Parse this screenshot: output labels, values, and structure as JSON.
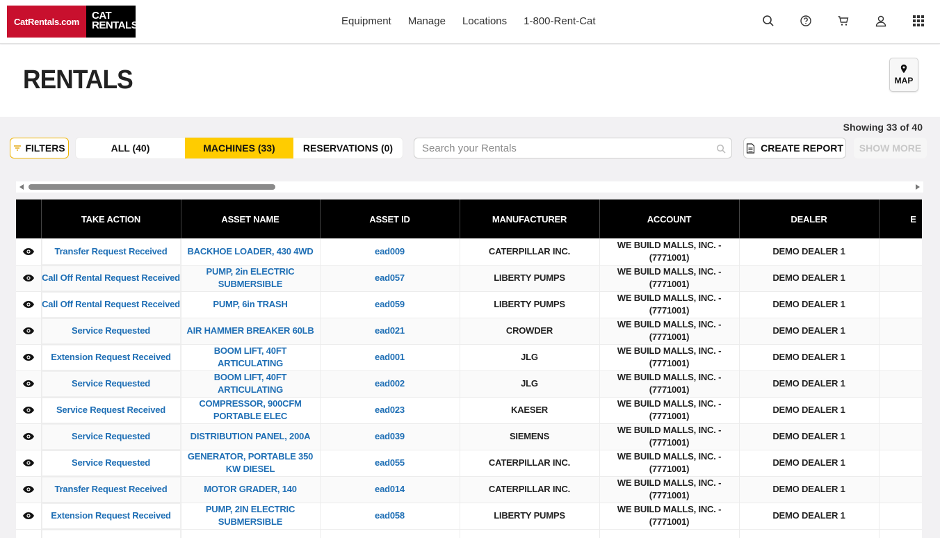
{
  "brand": {
    "logo_left": "CatRentals.com",
    "logo_cat": "CAT",
    "logo_rentals": "RENTALS",
    "accent": "#ffcc00",
    "red": "#c8102e"
  },
  "nav": {
    "items": [
      "Equipment",
      "Manage",
      "Locations",
      "1-800-Rent-Cat"
    ]
  },
  "top_icons": [
    "search-icon",
    "help-icon",
    "cart-icon",
    "user-icon",
    "apps-grid-icon"
  ],
  "header": {
    "title": "RENTALS",
    "map_label": "MAP"
  },
  "toolbar": {
    "showing": "Showing 33 of 40",
    "filters_label": "FILTERS",
    "tabs": [
      {
        "label": "ALL (40)",
        "selected": false
      },
      {
        "label": "MACHINES (33)",
        "selected": true
      },
      {
        "label": "RESERVATIONS (0)",
        "selected": false
      }
    ],
    "search_placeholder": "Search your Rentals",
    "create_report_label": "CREATE REPORT",
    "show_more_label": "SHOW MORE"
  },
  "table": {
    "columns": [
      "TAKE ACTION",
      "ASSET NAME",
      "ASSET ID",
      "MANUFACTURER",
      "ACCOUNT",
      "DEALER",
      "E"
    ],
    "rows": [
      {
        "action": "Transfer Request Received",
        "asset_name": "BACKHOE LOADER, 430 4WD",
        "asset_id": "ead009",
        "manufacturer": "CATERPILLAR INC.",
        "account": "WE BUILD MALLS, INC. - (7771001)",
        "dealer": "DEMO DEALER 1"
      },
      {
        "action": "Call Off Rental Request Received",
        "asset_name": "PUMP, 2in ELECTRIC SUBMERSIBLE",
        "asset_id": "ead057",
        "manufacturer": "LIBERTY PUMPS",
        "account": "WE BUILD MALLS, INC. - (7771001)",
        "dealer": "DEMO DEALER 1"
      },
      {
        "action": "Call Off Rental Request Received",
        "asset_name": "PUMP, 6in TRASH",
        "asset_id": "ead059",
        "manufacturer": "LIBERTY PUMPS",
        "account": "WE BUILD MALLS, INC. - (7771001)",
        "dealer": "DEMO DEALER 1"
      },
      {
        "action": "Service Requested",
        "asset_name": "AIR HAMMER BREAKER 60LB",
        "asset_id": "ead021",
        "manufacturer": "CROWDER",
        "account": "WE BUILD MALLS, INC. - (7771001)",
        "dealer": "DEMO DEALER 1"
      },
      {
        "action": "Extension Request Received",
        "asset_name": "BOOM LIFT, 40FT ARTICULATING",
        "asset_id": "ead001",
        "manufacturer": "JLG",
        "account": "WE BUILD MALLS, INC. - (7771001)",
        "dealer": "DEMO DEALER 1"
      },
      {
        "action": "Service Requested",
        "asset_name": "BOOM LIFT, 40FT ARTICULATING",
        "asset_id": "ead002",
        "manufacturer": "JLG",
        "account": "WE BUILD MALLS, INC. - (7771001)",
        "dealer": "DEMO DEALER 1"
      },
      {
        "action": "Service Request Received",
        "asset_name": "COMPRESSOR, 900CFM PORTABLE ELEC",
        "asset_id": "ead023",
        "manufacturer": "KAESER",
        "account": "WE BUILD MALLS, INC. - (7771001)",
        "dealer": "DEMO DEALER 1"
      },
      {
        "action": "Service Requested",
        "asset_name": "DISTRIBUTION PANEL, 200A",
        "asset_id": "ead039",
        "manufacturer": "SIEMENS",
        "account": "WE BUILD MALLS, INC. - (7771001)",
        "dealer": "DEMO DEALER 1"
      },
      {
        "action": "Service Requested",
        "asset_name": "GENERATOR, PORTABLE 350 KW DIESEL",
        "asset_id": "ead055",
        "manufacturer": "CATERPILLAR INC.",
        "account": "WE BUILD MALLS, INC. - (7771001)",
        "dealer": "DEMO DEALER 1"
      },
      {
        "action": "Transfer Request Received",
        "asset_name": "MOTOR GRADER, 140",
        "asset_id": "ead014",
        "manufacturer": "CATERPILLAR INC.",
        "account": "WE BUILD MALLS, INC. - (7771001)",
        "dealer": "DEMO DEALER 1"
      },
      {
        "action": "Extension Request Received",
        "asset_name": "PUMP, 2IN ELECTRIC SUBMERSIBLE",
        "asset_id": "ead058",
        "manufacturer": "LIBERTY PUMPS",
        "account": "WE BUILD MALLS, INC. - (7771001)",
        "dealer": "DEMO DEALER 1"
      }
    ]
  }
}
